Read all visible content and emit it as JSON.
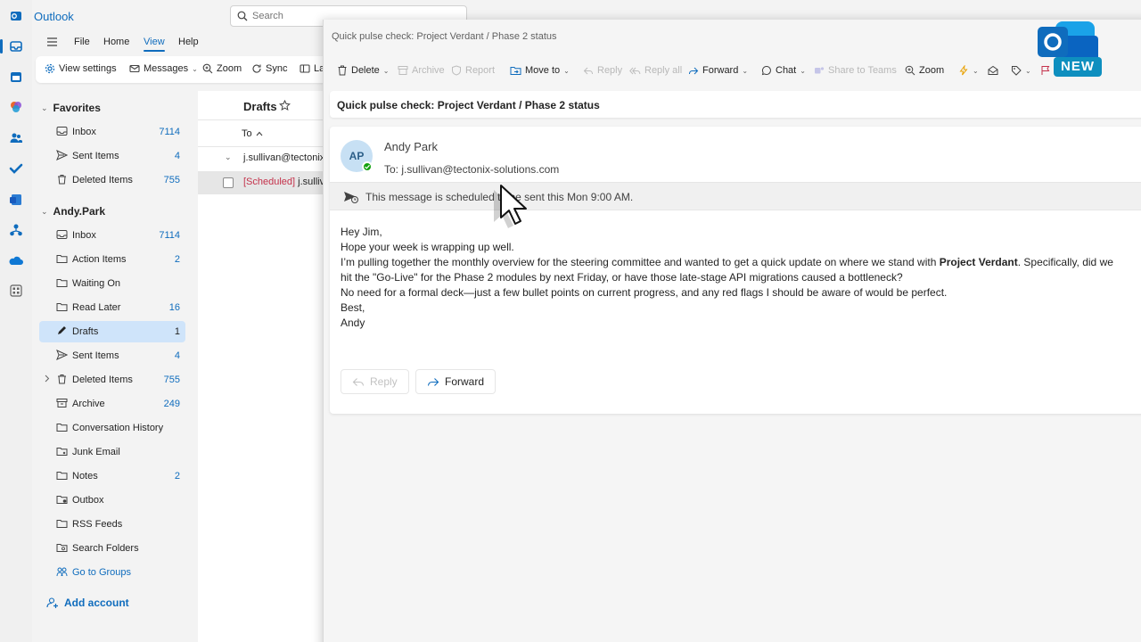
{
  "app": {
    "title": "Outlook"
  },
  "search": {
    "placeholder": "Search"
  },
  "menu": {
    "tabs": [
      "File",
      "Home",
      "View",
      "Help"
    ],
    "selected": "View"
  },
  "ribbon": {
    "view_settings": "View settings",
    "messages": "Messages",
    "zoom": "Zoom",
    "sync": "Sync",
    "layout": "La"
  },
  "favorites": {
    "header": "Favorites",
    "items": [
      {
        "label": "Inbox",
        "count": "7114"
      },
      {
        "label": "Sent Items",
        "count": "4"
      },
      {
        "label": "Deleted Items",
        "count": "755"
      }
    ]
  },
  "account": {
    "header": "Andy.Park",
    "items": [
      {
        "label": "Inbox",
        "count": "7114"
      },
      {
        "label": "Action Items",
        "count": "2"
      },
      {
        "label": "Waiting On",
        "count": ""
      },
      {
        "label": "Read Later",
        "count": "16"
      },
      {
        "label": "Drafts",
        "count": "1"
      },
      {
        "label": "Sent Items",
        "count": "4"
      },
      {
        "label": "Deleted Items",
        "count": "755"
      },
      {
        "label": "Archive",
        "count": "249"
      },
      {
        "label": "Conversation History",
        "count": ""
      },
      {
        "label": "Junk Email",
        "count": ""
      },
      {
        "label": "Notes",
        "count": "2"
      },
      {
        "label": "Outbox",
        "count": ""
      },
      {
        "label": "RSS Feeds",
        "count": ""
      },
      {
        "label": "Search Folders",
        "count": ""
      },
      {
        "label": "Go to Groups",
        "count": ""
      }
    ],
    "add_account": "Add account"
  },
  "list": {
    "title": "Drafts",
    "sort_label": "To",
    "group_header": "j.sullivan@tectonix",
    "row_tag": "[Scheduled]",
    "row_to": " j.sulliva"
  },
  "reader": {
    "window_title": "Quick pulse check: Project Verdant / Phase 2 status",
    "toolbar": {
      "delete": "Delete",
      "archive": "Archive",
      "report": "Report",
      "move_to": "Move to",
      "reply": "Reply",
      "reply_all": "Reply all",
      "forward": "Forward",
      "chat": "Chat",
      "share_teams": "Share to Teams",
      "zoom": "Zoom"
    },
    "subject": "Quick pulse check: Project Verdant / Phase 2 status",
    "avatar_initials": "AP",
    "sender": "Andy Park",
    "to_label": "To:",
    "to_address": "j.sullivan@tectonix-solutions.com",
    "scheduled_notice": "This message is scheduled to be sent this Mon 9:00 AM.",
    "body": {
      "greeting": "Hey Jim,",
      "line1": "Hope your week is wrapping up well.",
      "line2_pre": "I’m pulling together the monthly overview for the steering committee and wanted to get a quick update on where we stand with ",
      "line2_bold": "Project Verdant",
      "line2_post": ". Specifically, did we",
      "line3": "hit the \"Go-Live\" for the Phase 2 modules by next Friday, or have those late-stage API migrations caused a bottleneck?",
      "line4": "No need for a formal deck—just a few bullet points on current progress, and any red flags I should be aware of would be perfect.",
      "closing": "Best,",
      "signature": "Andy"
    },
    "reply_button": "Reply",
    "forward_button": "Forward"
  },
  "badge": {
    "label": "NEW"
  },
  "colors": {
    "accent": "#0f6cbd",
    "selected_folder": "#cfe4fa",
    "scheduled": "#c4314b"
  }
}
